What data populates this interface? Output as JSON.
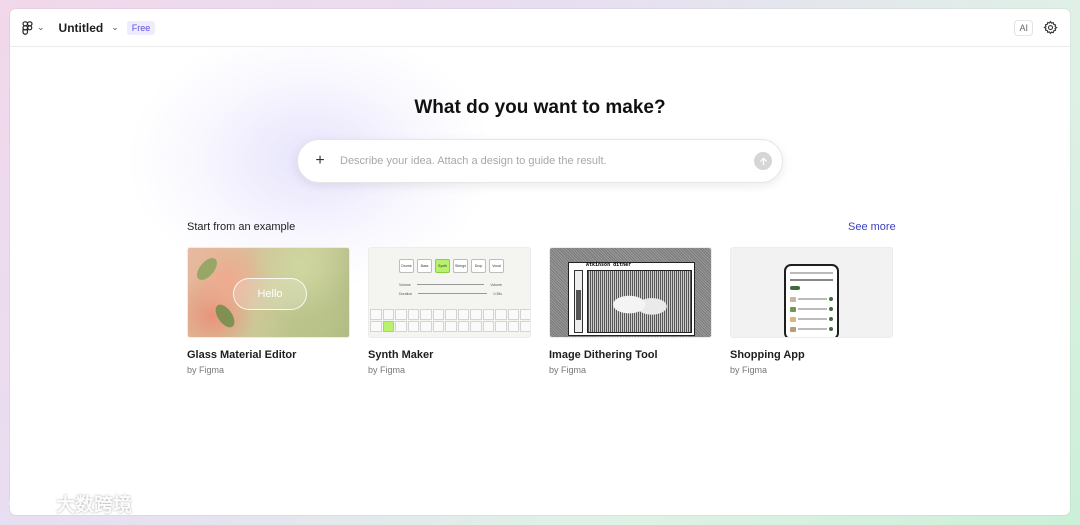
{
  "app": {
    "file_title": "Untitled",
    "plan_badge": "Free",
    "ai_label": "AI"
  },
  "main": {
    "heading": "What do you want to make?",
    "prompt": {
      "placeholder": "Describe your idea. Attach a design to guide the result.",
      "value": ""
    },
    "examples_label": "Start from an example",
    "see_more_label": "See more",
    "examples": [
      {
        "title": "Glass Material Editor",
        "author": "by Figma",
        "thumb_text": "Hello"
      },
      {
        "title": "Synth Maker",
        "author": "by Figma",
        "thumb_tabs": [
          "Drums",
          "Bass",
          "Synth",
          "Strings",
          "Drop",
          "Vocal"
        ],
        "thumb_rows": [
          [
            "Volume",
            "Volume"
          ],
          [
            "Duration",
            "0.35s"
          ]
        ]
      },
      {
        "title": "Image Dithering Tool",
        "author": "by Figma",
        "thumb_title": "Atkinson dither"
      },
      {
        "title": "Shopping App",
        "author": "by Figma"
      }
    ]
  },
  "watermark": "大数跨境",
  "colors": {
    "accent": "#3b3fbd",
    "badge": "#5b4fe0",
    "synth_active": "#b8f26c",
    "shop_green": "#3d6b3a"
  },
  "icons": {
    "logo": "figma-logo-icon",
    "settings": "gear-icon",
    "add": "plus-icon",
    "send": "arrow-up-icon"
  }
}
